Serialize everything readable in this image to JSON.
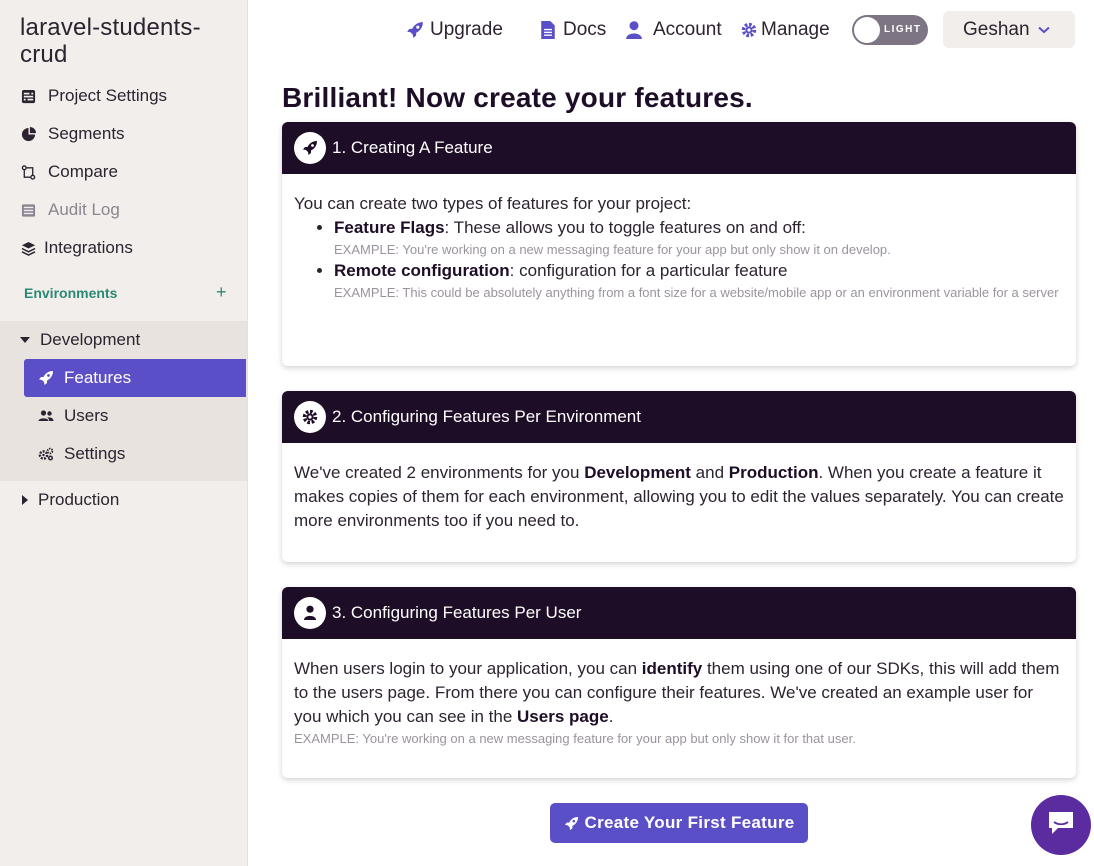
{
  "project": {
    "title": "laravel-students-crud"
  },
  "sidebar": {
    "items": [
      {
        "label": "Project Settings",
        "icon": "sliders-icon"
      },
      {
        "label": "Segments",
        "icon": "pie-chart-icon"
      },
      {
        "label": "Compare",
        "icon": "git-compare-icon"
      },
      {
        "label": "Audit Log",
        "icon": "list-icon"
      },
      {
        "label": "Integrations",
        "icon": "layers-icon"
      }
    ],
    "environments_label": "Environments",
    "add_symbol": "+",
    "environments": [
      {
        "name": "Development",
        "expanded": true,
        "items": [
          {
            "label": "Features",
            "icon": "rocket-icon",
            "active": true
          },
          {
            "label": "Users",
            "icon": "users-icon",
            "active": false
          },
          {
            "label": "Settings",
            "icon": "cogs-icon",
            "active": false
          }
        ]
      },
      {
        "name": "Production",
        "expanded": false
      }
    ]
  },
  "header": {
    "upgrade": "Upgrade",
    "docs": "Docs",
    "account": "Account",
    "manage": "Manage",
    "theme_toggle": "LIGHT",
    "user": "Geshan"
  },
  "main": {
    "title": "Brilliant! Now create your features.",
    "cards": [
      {
        "title": "1. Creating A Feature",
        "intro": "You can create two types of features for your project:",
        "items": [
          {
            "term": "Feature Flags",
            "text": ": These allows you to toggle features on and off:",
            "example": "EXAMPLE: You're working on a new messaging feature for your app but only show it on develop."
          },
          {
            "term": "Remote configuration",
            "text": ": configuration for a particular feature",
            "example": "EXAMPLE: This could be absolutely anything from a font size for a website/mobile app or an environment variable for a server"
          }
        ]
      },
      {
        "title": "2. Configuring Features Per Environment",
        "p1": "We've created 2 environments for you ",
        "b1": "Development",
        "p2": " and ",
        "b2": "Production",
        "p3": ". When you create a feature it makes copies of them for each environment, allowing you to edit the values separately. You can create more environments too if you need to."
      },
      {
        "title": "3. Configuring Features Per User",
        "p1": "When users login to your application, you can ",
        "b1": "identify",
        "p2": " them using one of our SDKs, this will add them to the users page. From there you can configure their features. We've created an example user for you which you can see in the ",
        "b2": "Users page",
        "p3": ".",
        "example": "EXAMPLE: You're working on a new messaging feature for your app but only show it for that user."
      }
    ],
    "cta": "Create Your First Feature"
  },
  "colors": {
    "accent": "#5b4fc7",
    "header_dark": "#1e0d26",
    "env_green": "#2b8a74",
    "chat": "#5b2c9f"
  }
}
